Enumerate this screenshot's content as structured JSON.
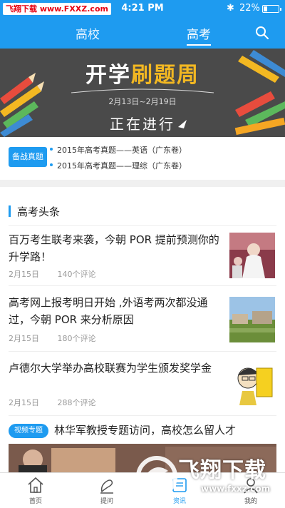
{
  "status_bar": {
    "watermark": {
      "part1": "飞翔下载",
      "part2": "www.FXXZ.com"
    },
    "time": "4:21 PM",
    "battery": "22%"
  },
  "top_nav": {
    "tabs": [
      {
        "label": "高校"
      },
      {
        "label": "高考"
      }
    ],
    "active_tab": "高考"
  },
  "banner": {
    "title_part1": "开学",
    "title_part2": "刷题周",
    "date_range": "2月13日~2月19日",
    "status_text": "正在进行"
  },
  "exam_section": {
    "badge": "备战真题",
    "links": [
      "2015年高考真题——英语（广东卷）",
      "2015年高考真题——理综（广东卷）"
    ]
  },
  "section_header": "高考头条",
  "news": [
    {
      "title": "百万考生联考来袭，今朝 POR 提前预测你的升学路！",
      "date": "2月15日",
      "comments": "140个评论"
    },
    {
      "title": "高考网上报考明日开始 ,外语考两次都没通过，今朝 POR 来分析原因",
      "date": "2月15日",
      "comments": "180个评论"
    },
    {
      "title": "卢德尔大学举办高校联赛为学生颁发奖学金",
      "date": "2月15日",
      "comments": "288个评论"
    }
  ],
  "video_item": {
    "badge": "视频专题",
    "title": "林华军教授专题访问，高校怎么留人才"
  },
  "tabbar": {
    "items": [
      {
        "label": "首页"
      },
      {
        "label": "提问"
      },
      {
        "label": "资讯"
      },
      {
        "label": "我的"
      }
    ],
    "active": "资讯"
  },
  "overlay_watermark": {
    "title": "飞翔下载",
    "url": "www.fxxz.com"
  },
  "colors": {
    "primary": "#1e9bf0",
    "banner_bg": "#4a4a4a",
    "accent_yellow": "#f3b822"
  }
}
